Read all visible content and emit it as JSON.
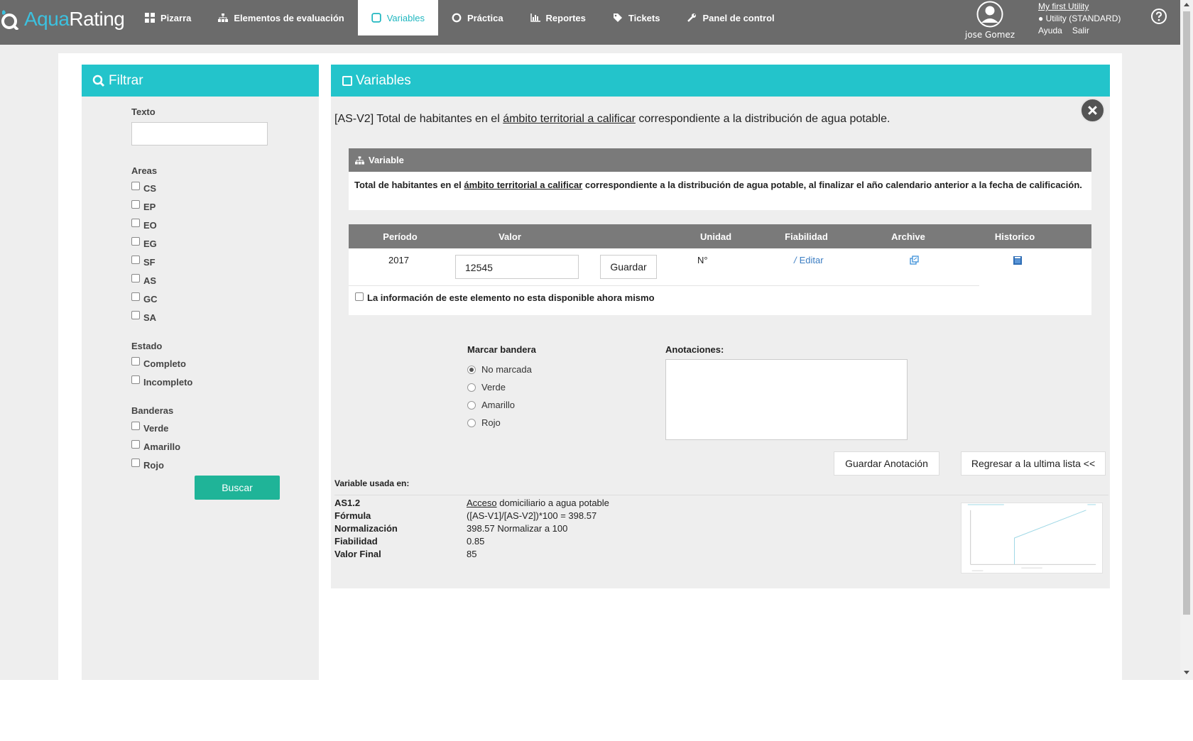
{
  "brand": {
    "aqua": "Aqua",
    "rating": "Rating"
  },
  "nav": [
    {
      "label": "Pizarra",
      "icon": "grid-icon"
    },
    {
      "label": "Elementos de evaluación",
      "icon": "sitemap-icon"
    },
    {
      "label": "Variables",
      "icon": "square-icon",
      "active": true
    },
    {
      "label": "Práctica",
      "icon": "circle-icon"
    },
    {
      "label": "Reportes",
      "icon": "bar-chart-icon"
    },
    {
      "label": "Tickets",
      "icon": "tags-icon"
    },
    {
      "label": "Panel de control",
      "icon": "wrench-icon"
    }
  ],
  "user": {
    "name": "jose Gomez"
  },
  "utility": {
    "link": "My first Utility",
    "current": "● Utility (STANDARD)",
    "help": "Ayuda",
    "logout": "Salir"
  },
  "filter": {
    "title": "Filtrar",
    "text_label": "Texto",
    "text_value": "",
    "areas_label": "Areas",
    "areas": [
      "CS",
      "EP",
      "EO",
      "EG",
      "SF",
      "AS",
      "GC",
      "SA"
    ],
    "estado_label": "Estado",
    "estados": [
      "Completo",
      "Incompleto"
    ],
    "banderas_label": "Banderas",
    "banderas": [
      "Verde",
      "Amarillo",
      "Rojo"
    ],
    "search_button": "Buscar"
  },
  "variables": {
    "title": "Variables",
    "heading_prefix": "[AS-V2] Total de habitantes en el ",
    "heading_link": "ámbito territorial a calificar",
    "heading_suffix": " correspondiente a la distribución de agua potable.",
    "variable_bar": "Variable",
    "desc_prefix": "Total de habitantes en el ",
    "desc_link": "ámbito territorial a calificar",
    "desc_suffix": " correspondiente a la distribución de agua potable, al finalizar el año calendario anterior a la fecha de calificación.",
    "columns": [
      "Período",
      "Valor",
      "Unidad",
      "Fiabilidad",
      "Archive",
      "Historico"
    ],
    "row": {
      "period": "2017",
      "value": "12545",
      "save": "Guardar",
      "unit": "N°",
      "reliability_edit": "Editar"
    },
    "unavailable": "La información de este elemento no esta disponible ahora mismo",
    "flag_title": "Marcar bandera",
    "flags": [
      "No marcada",
      "Verde",
      "Amarillo",
      "Rojo"
    ],
    "flag_selected": "No marcada",
    "notes_title": "Anotaciones:",
    "notes_value": "",
    "save_note": "Guardar Anotación",
    "back": "Regresar a la ultima lista <<",
    "used_in": "Variable usada en:",
    "details": {
      "indicator_key": "AS1.2",
      "indicator_link": "Acceso",
      "indicator_rest": " domiciliario a agua potable",
      "formula_key": "Fórmula",
      "formula": "([AS-V1]/[AS-V2])*100 = 398.57",
      "norm_key": "Normalización",
      "norm": "398.57 Normalizar a 100",
      "rel_key": "Fiabilidad",
      "rel": "0.85",
      "final_key": "Valor Final",
      "final": "85"
    }
  },
  "colors": {
    "topbar": "#6b6b6b",
    "accent": "#23c4cb",
    "search_btn": "#1fb498",
    "table_header": "#7a7a7a"
  }
}
